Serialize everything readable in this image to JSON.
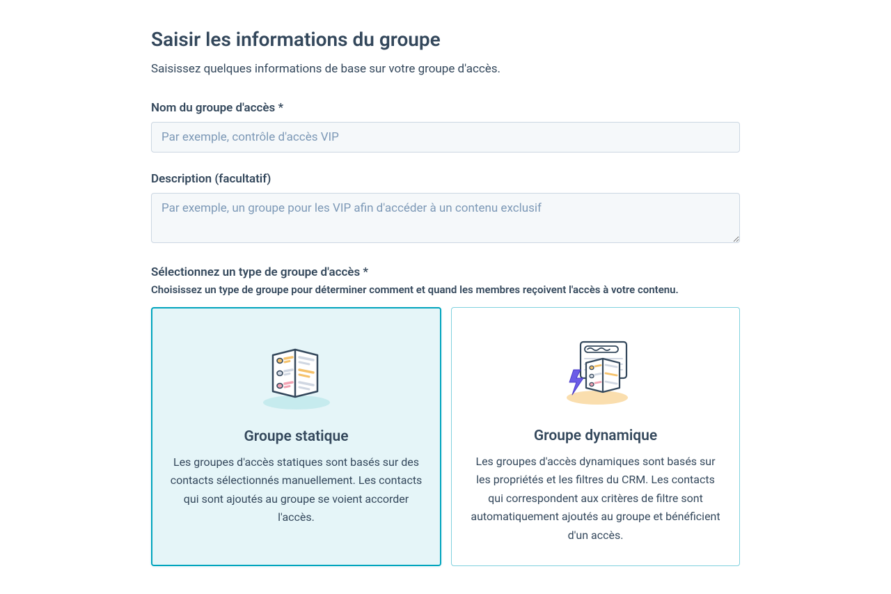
{
  "header": {
    "title": "Saisir les informations du groupe",
    "subtitle": "Saisissez quelques informations de base sur votre groupe d'accès."
  },
  "form": {
    "name": {
      "label": "Nom du groupe d'accès *",
      "placeholder": "Par exemple, contrôle d'accès VIP",
      "value": ""
    },
    "description": {
      "label": "Description (facultatif)",
      "placeholder": "Par exemple, un groupe pour les VIP afin d'accéder à un contenu exclusif",
      "value": ""
    },
    "groupType": {
      "label": "Sélectionnez un type de groupe d'accès *",
      "help": "Choisissez un type de groupe pour déterminer comment et quand les membres reçoivent l'accès à votre contenu."
    }
  },
  "options": {
    "static": {
      "title": "Groupe statique",
      "description": "Les groupes d'accès statiques sont basés sur des contacts sélectionnés manuellement. Les contacts qui sont ajoutés au groupe se voient accorder l'accès.",
      "selected": true
    },
    "dynamic": {
      "title": "Groupe dynamique",
      "description": "Les groupes d'accès dynamiques sont basés sur les propriétés et les filtres du CRM. Les contacts qui correspondent aux critères de filtre sont automatiquement ajoutés au groupe et bénéficient d'un accès.",
      "selected": false
    }
  }
}
